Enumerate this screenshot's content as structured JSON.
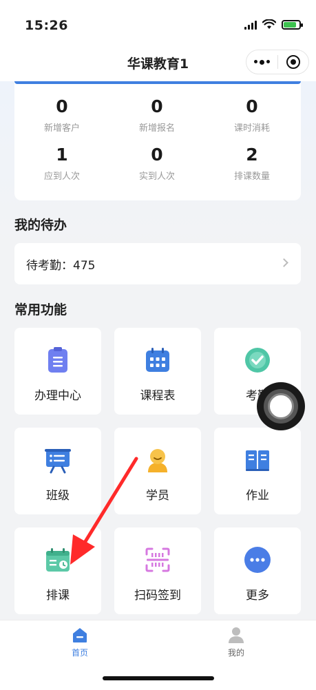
{
  "status": {
    "time": "15:26"
  },
  "nav": {
    "title": "华课教育1"
  },
  "stats": [
    {
      "value": "0",
      "label": "新增客户"
    },
    {
      "value": "0",
      "label": "新增报名"
    },
    {
      "value": "0",
      "label": "课时消耗"
    },
    {
      "value": "1",
      "label": "应到人次"
    },
    {
      "value": "0",
      "label": "实到人次"
    },
    {
      "value": "2",
      "label": "排课数量"
    }
  ],
  "todo": {
    "title": "我的待办",
    "item": "待考勤：475"
  },
  "functions": {
    "title": "常用功能",
    "items": [
      {
        "label": "办理中心",
        "icon": "clipboard-icon"
      },
      {
        "label": "课程表",
        "icon": "calendar-icon"
      },
      {
        "label": "考勤",
        "icon": "check-circle-icon"
      },
      {
        "label": "班级",
        "icon": "class-board-icon"
      },
      {
        "label": "学员",
        "icon": "student-icon"
      },
      {
        "label": "作业",
        "icon": "book-icon"
      },
      {
        "label": "排课",
        "icon": "schedule-icon"
      },
      {
        "label": "扫码签到",
        "icon": "scan-icon"
      },
      {
        "label": "更多",
        "icon": "more-icon"
      }
    ]
  },
  "tabs": [
    {
      "label": "首页",
      "icon": "home-icon",
      "active": true
    },
    {
      "label": "我的",
      "icon": "user-icon",
      "active": false
    }
  ],
  "colors": {
    "accent": "#3f7fe0",
    "arrow": "#ff2a2a",
    "battery": "#3dc24f"
  }
}
